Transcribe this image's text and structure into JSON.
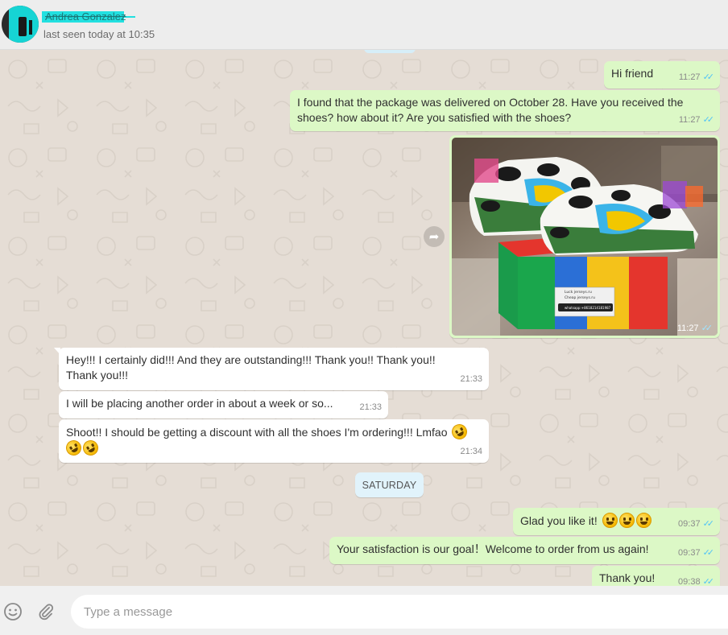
{
  "header": {
    "contact_name": "Andrea Gonzalez",
    "last_seen": "last seen today at 10:35"
  },
  "messages": [
    {
      "dir": "out",
      "text": "Hi friend",
      "time": "11:27",
      "ticks": "✓✓"
    },
    {
      "dir": "out",
      "text": "I found that the package was delivered on October 28. Have you received the shoes? how about it? Are you satisfied with the shoes?",
      "time": "11:27",
      "ticks": "✓✓"
    },
    {
      "dir": "out",
      "type": "image",
      "alt": "sneakers on box",
      "time": "11:27",
      "ticks": "✓✓"
    },
    {
      "dir": "in",
      "text": "Hey!!! I certainly did!!! And they are outstanding!!! Thank you!! Thank you!! Thank you!!!",
      "time": "21:33"
    },
    {
      "dir": "in",
      "text": "I will be placing another order in about a week or so...",
      "time": "21:33"
    },
    {
      "dir": "in",
      "text": "Shoot!! I should be getting a discount with all the shoes I'm ordering!!! Lmfao",
      "time": "21:34"
    },
    {
      "dir": "out",
      "text": "Glad you like it!",
      "time": "09:37",
      "ticks": "✓✓"
    },
    {
      "dir": "out",
      "text": "Your satisfaction is our goal！Welcome to order from us again!",
      "time": "09:37",
      "ticks": "✓✓"
    },
    {
      "dir": "out",
      "text": "Thank you!",
      "time": "09:38",
      "ticks": "✓✓"
    }
  ],
  "day_divider": "SATURDAY",
  "box_label": {
    "line1": "Luck jerseys.ru",
    "line2": "Cheap jerseys.ru",
    "line3": "whatsapp:+8618214181987"
  },
  "composer": {
    "placeholder": "Type a message",
    "emoji_icon": "smiley-icon",
    "attach_icon": "paperclip-icon"
  },
  "colors": {
    "outgoing_bubble": "#dcf8c6",
    "incoming_bubble": "#ffffff",
    "chat_background": "#e5ddd5",
    "tick_read": "#4fc3f7"
  }
}
